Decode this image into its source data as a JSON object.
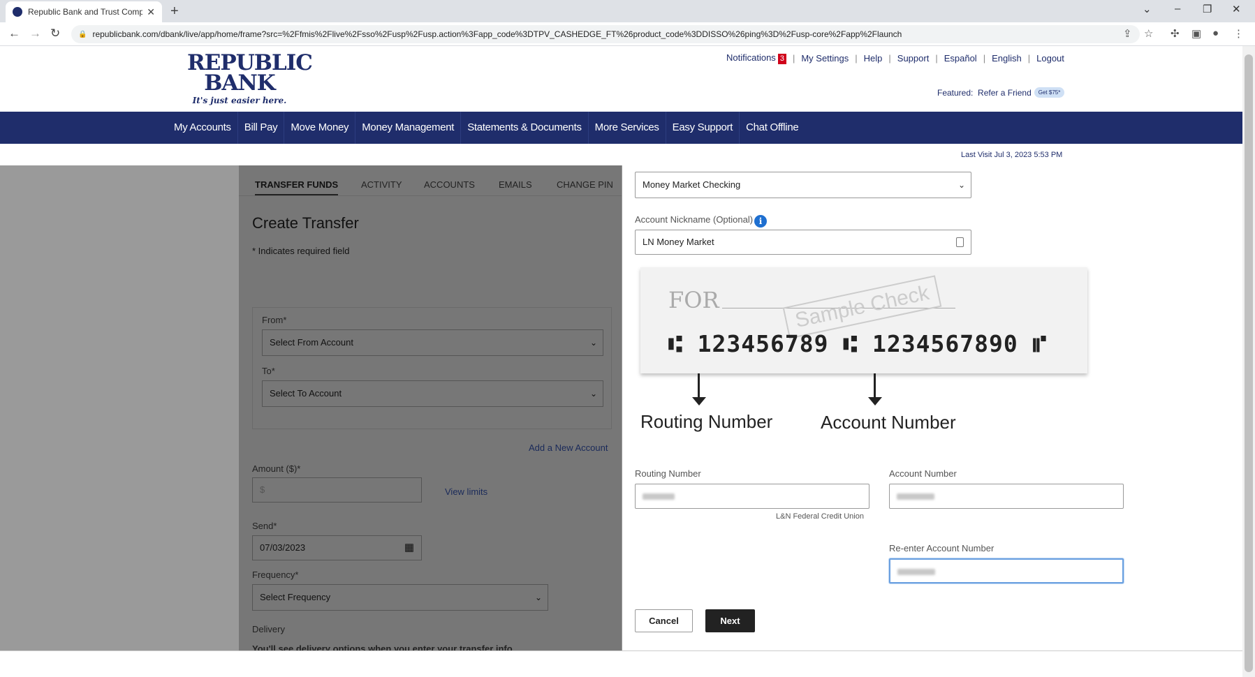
{
  "browser": {
    "tab_title": "Republic Bank and Trust Compan",
    "url": "republicbank.com/dbank/live/app/home/frame?src=%2Ffmis%2Flive%2Fsso%2Fusp%2Fusp.action%3Fapp_code%3DTPV_CASHEDGE_FT%26product_code%3DDISSO%26ping%3D%2Fusp-core%2Fapp%2Flaunch"
  },
  "header": {
    "logo_line1": "REPUBLIC",
    "logo_line2": "BANK",
    "logo_tagline": "It's just easier here.",
    "notifications_label": "Notifications",
    "notifications_count": "3",
    "util_links": [
      "My Settings",
      "Help",
      "Support",
      "Español",
      "English",
      "Logout"
    ],
    "featured_label": "Featured:",
    "featured_link": "Refer a Friend",
    "featured_pill": "Get $75*",
    "last_visit": "Last Visit Jul 3, 2023 5:53 PM"
  },
  "nav": {
    "items": [
      "My Accounts",
      "Bill Pay",
      "Move Money",
      "Money Management",
      "Statements & Documents",
      "More Services",
      "Easy Support",
      "Chat Offline"
    ]
  },
  "left": {
    "tabs": [
      "TRANSFER FUNDS",
      "ACTIVITY",
      "ACCOUNTS",
      "EMAILS",
      "CHANGE PIN"
    ],
    "title": "Create Transfer",
    "required_note": "* Indicates required field",
    "from_label": "From*",
    "from_value": "Select From Account",
    "to_label": "To*",
    "to_value": "Select To Account",
    "add_account": "Add a New Account",
    "amount_label": "Amount ($)*",
    "amount_placeholder": "$",
    "view_limits": "View limits",
    "send_label": "Send*",
    "send_value": "07/03/2023",
    "frequency_label": "Frequency*",
    "frequency_value": "Select Frequency",
    "delivery_label": "Delivery",
    "delivery_note": "You'll see delivery options when you enter your transfer info"
  },
  "right": {
    "account_type_value": "Money Market Checking",
    "nickname_label": "Account Nickname (Optional)",
    "nickname_value": "LN Money Market",
    "check": {
      "for_text": "FOR",
      "stamp": "Sample Check",
      "micr": "⑆ 123456789 ⑆ 1234567890 ⑈",
      "routing_caption": "Routing Number",
      "account_caption": "Account Number"
    },
    "routing_label": "Routing Number",
    "routing_note": "L&N Federal Credit Union",
    "account_label": "Account Number",
    "reenter_label": "Re-enter Account Number",
    "cancel": "Cancel",
    "next": "Next"
  }
}
